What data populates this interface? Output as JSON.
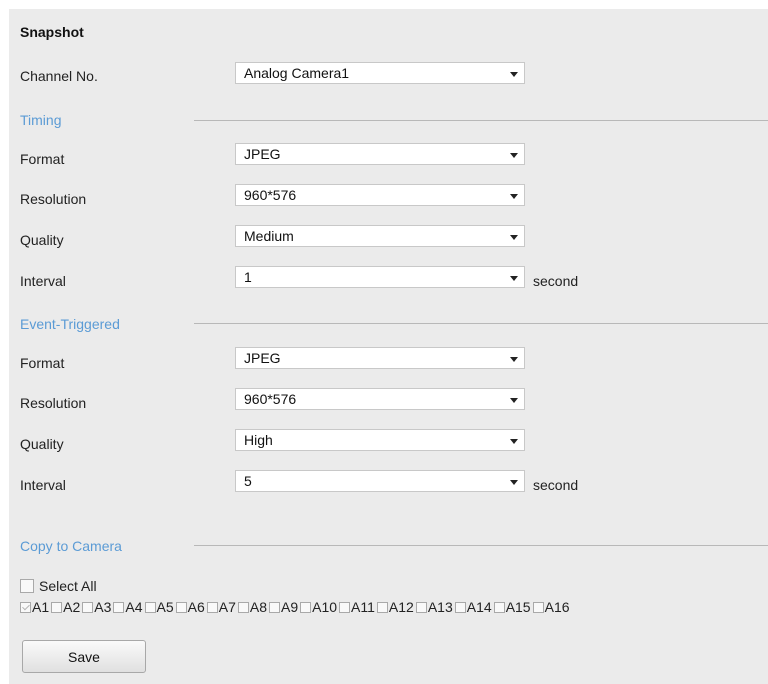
{
  "title": "Snapshot",
  "channel": {
    "label": "Channel No.",
    "value": "Analog Camera1"
  },
  "timing": {
    "section": "Timing",
    "format": {
      "label": "Format",
      "value": "JPEG"
    },
    "resolution": {
      "label": "Resolution",
      "value": "960*576"
    },
    "quality": {
      "label": "Quality",
      "value": "Medium"
    },
    "interval": {
      "label": "Interval",
      "value": "1",
      "unit": "second"
    }
  },
  "event": {
    "section": "Event-Triggered",
    "format": {
      "label": "Format",
      "value": "JPEG"
    },
    "resolution": {
      "label": "Resolution",
      "value": "960*576"
    },
    "quality": {
      "label": "Quality",
      "value": "High"
    },
    "interval": {
      "label": "Interval",
      "value": "5",
      "unit": "second"
    }
  },
  "copy": {
    "section": "Copy to Camera",
    "select_all": "Select All",
    "cameras": [
      {
        "label": "A1",
        "checked": true
      },
      {
        "label": "A2",
        "checked": false
      },
      {
        "label": "A3",
        "checked": false
      },
      {
        "label": "A4",
        "checked": false
      },
      {
        "label": "A5",
        "checked": false
      },
      {
        "label": "A6",
        "checked": false
      },
      {
        "label": "A7",
        "checked": false
      },
      {
        "label": "A8",
        "checked": false
      },
      {
        "label": "A9",
        "checked": false
      },
      {
        "label": "A10",
        "checked": false
      },
      {
        "label": "A11",
        "checked": false
      },
      {
        "label": "A12",
        "checked": false
      },
      {
        "label": "A13",
        "checked": false
      },
      {
        "label": "A14",
        "checked": false
      },
      {
        "label": "A15",
        "checked": false
      },
      {
        "label": "A16",
        "checked": false
      }
    ]
  },
  "save_label": "Save",
  "colors": {
    "section": "#5b9bd5",
    "panel": "#ebebeb"
  }
}
